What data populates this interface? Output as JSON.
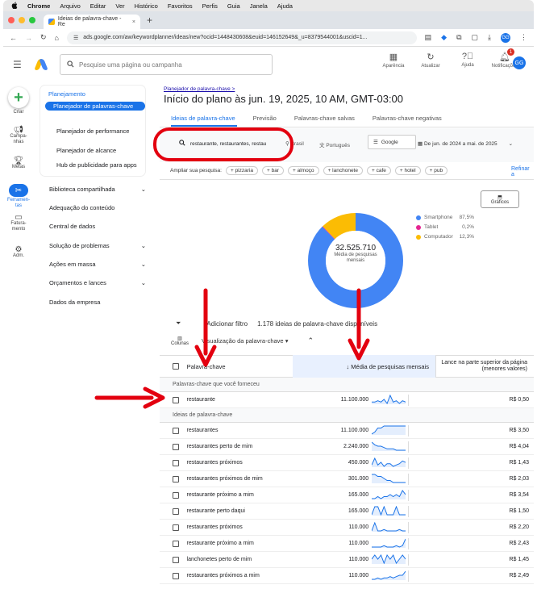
{
  "menubar": {
    "apple": "",
    "app": "Chrome",
    "items": [
      "Arquivo",
      "Editar",
      "Ver",
      "Histórico",
      "Favoritos",
      "Perfis",
      "Guia",
      "Janela",
      "Ajuda"
    ]
  },
  "browser": {
    "tab_title": "Ideias de palavra-chave - Re",
    "new_tab": "+",
    "tab_close": "×",
    "url": "ads.google.com/aw/keywordplanner/ideas/new?ocid=1448430608&euid=146152649&_u=8379544001&uscid=1...",
    "avatar": "GG"
  },
  "header": {
    "search_placeholder": "Pesquise uma página ou campanha",
    "buttons": [
      {
        "label": "Aparência",
        "icon": "appearance-icon"
      },
      {
        "label": "Atualizar",
        "icon": "refresh-icon"
      },
      {
        "label": "Ajuda",
        "icon": "help-icon"
      },
      {
        "label": "Notificações",
        "icon": "bell-icon",
        "badge": "1"
      }
    ],
    "avatar": "GG"
  },
  "rail": {
    "items": [
      {
        "label": "Criar",
        "icon": "plus-icon"
      },
      {
        "label": "Campa-nhas",
        "icon": "megaphone-icon"
      },
      {
        "label": "Metas",
        "icon": "trophy-icon"
      },
      {
        "label": "Ferramen-tas",
        "icon": "tools-icon",
        "active": true
      },
      {
        "label": "Fatura-mento",
        "icon": "billing-icon"
      },
      {
        "label": "Adm.",
        "icon": "settings-icon"
      }
    ]
  },
  "nav": {
    "section": "Planejamento",
    "subitems": [
      "Planejador de palavras-chave",
      "Planejador de performance",
      "Planejador de alcance",
      "Hub de publicidade para apps"
    ],
    "items": [
      {
        "label": "Biblioteca compartilhada",
        "chevron": true
      },
      {
        "label": "Adequação do conteúdo",
        "chevron": false
      },
      {
        "label": "Central de dados",
        "chevron": false
      },
      {
        "label": "Solução de problemas",
        "chevron": true
      },
      {
        "label": "Ações em massa",
        "chevron": true
      },
      {
        "label": "Orçamentos e lances",
        "chevron": true
      },
      {
        "label": "Dados da empresa",
        "chevron": false
      }
    ]
  },
  "main": {
    "breadcrumb": "Planejador de palavra-chave >",
    "title": "Início do plano às jun. 19, 2025, 10 AM, GMT-03:00",
    "tabs": [
      "Ideias de palavra-chave",
      "Previsão",
      "Palavras-chave salvas",
      "Palavras-chave negativas"
    ],
    "keywords_input": "restaurante, restaurantes, restau",
    "location": "Brasil",
    "language": "Português",
    "network": "Google",
    "date_range": "De jun. de 2024 a mai. de 2025",
    "broaden_label": "Ampliar sua pesquisa:",
    "chips": [
      "pizzaria",
      "bar",
      "almoço",
      "lanchonete",
      "cafe",
      "hotel",
      "pub"
    ],
    "refine": "Refinar a",
    "graphs_btn": "Gráficos",
    "donut_total": "32.525.710",
    "donut_caption": "Média de pesquisas mensais",
    "legend": [
      {
        "name": "Smartphone",
        "pct": "87,5%",
        "color": "#4285f4"
      },
      {
        "name": "Tablet",
        "pct": "0,2%",
        "color": "#e52592"
      },
      {
        "name": "Computador",
        "pct": "12,3%",
        "color": "#fbbc04"
      }
    ],
    "add_filter": "Adicionar filtro",
    "ideas_count": "1.178 ideias de palavra-chave disponíveis",
    "columns_btn": "Colunas",
    "aggregation": "Visualização da palavra-chave"
  },
  "table": {
    "headers": {
      "keyword": "Palavra-chave",
      "volume": "↓ Média de pesquisas mensais",
      "bid": "Lance na parte superior da página (menores valores)"
    },
    "section_provided": "Palavras-chave que você forneceu",
    "section_ideas": "Ideias de palavra-chave",
    "provided": [
      {
        "kw": "restaurante",
        "vol": "11.100.000",
        "bid": "R$ 0,50",
        "spark": [
          5,
          5,
          6,
          5,
          7,
          4,
          10,
          5,
          6,
          4,
          6,
          5
        ]
      }
    ],
    "ideas": [
      {
        "kw": "restaurantes",
        "vol": "11.100.000",
        "bid": "R$ 3,50",
        "spark": [
          5,
          6,
          8,
          8,
          9,
          9,
          9,
          9,
          9,
          9,
          9,
          9
        ]
      },
      {
        "kw": "restaurantes perto de mim",
        "vol": "2.240.000",
        "bid": "R$ 4,04",
        "spark": [
          9,
          7,
          6,
          6,
          5,
          4,
          4,
          4,
          3,
          3,
          3,
          3
        ]
      },
      {
        "kw": "restaurantes próximos",
        "vol": "450.000",
        "bid": "R$ 1,43",
        "spark": [
          3,
          8,
          3,
          5,
          2,
          4,
          4,
          2,
          3,
          4,
          6,
          5
        ]
      },
      {
        "kw": "restaurantes próximos de mim",
        "vol": "301.000",
        "bid": "R$ 2,03",
        "spark": [
          8,
          8,
          7,
          7,
          6,
          5,
          5,
          4,
          4,
          4,
          4,
          4
        ]
      },
      {
        "kw": "restaurante próximo a mim",
        "vol": "165.000",
        "bid": "R$ 3,54",
        "spark": [
          4,
          4,
          5,
          4,
          5,
          5,
          6,
          5,
          6,
          5,
          8,
          6
        ]
      },
      {
        "kw": "restaurante perto daqui",
        "vol": "165.000",
        "bid": "R$ 1,50",
        "spark": [
          6,
          7,
          7,
          6,
          7,
          6,
          6,
          6,
          7,
          6,
          6,
          6
        ]
      },
      {
        "kw": "restaurantes próximos",
        "vol": "110.000",
        "bid": "R$ 2,20",
        "spark": [
          3,
          9,
          3,
          3,
          4,
          3,
          3,
          3,
          3,
          4,
          3,
          3
        ]
      },
      {
        "kw": "restaurante próximo a mim",
        "vol": "110.000",
        "bid": "R$ 2,43",
        "spark": [
          3,
          3,
          3,
          3,
          4,
          3,
          3,
          3,
          4,
          3,
          4,
          9
        ]
      },
      {
        "kw": "lanchonetes perto de mim",
        "vol": "110.000",
        "bid": "R$ 1,45",
        "spark": [
          5,
          6,
          5,
          6,
          4,
          6,
          5,
          6,
          4,
          5,
          6,
          5
        ]
      },
      {
        "kw": "restaurantes próximos a mim",
        "vol": "110.000",
        "bid": "R$ 2,49",
        "spark": [
          3,
          3,
          4,
          3,
          4,
          4,
          5,
          4,
          5,
          6,
          6,
          9
        ]
      }
    ]
  },
  "colors": {
    "accent": "#1a73e8",
    "annotation": "#e3000f",
    "spark": "#1a73e8"
  }
}
